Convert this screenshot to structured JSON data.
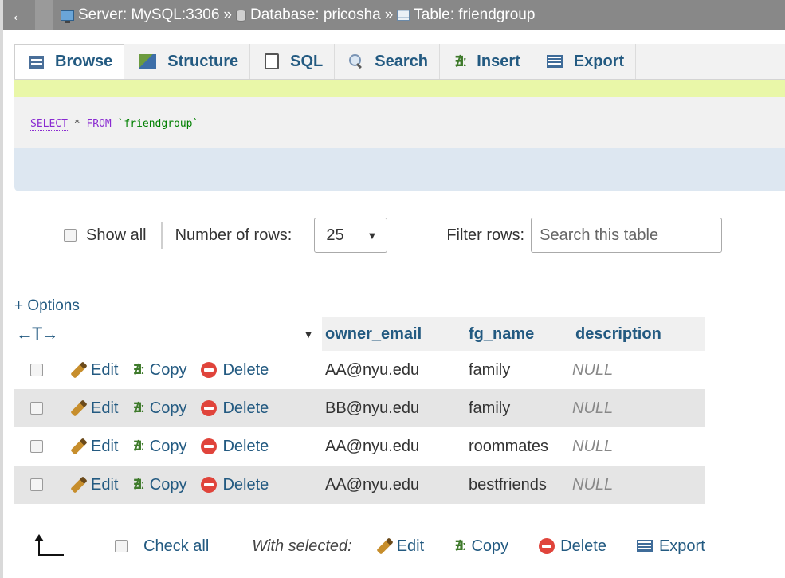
{
  "breadcrumb": {
    "back": "←",
    "server": "Server: MySQL:3306",
    "database": "Database: pricosha",
    "table": "Table: friendgroup",
    "separator": "»"
  },
  "tabs": [
    {
      "label": "Browse",
      "icon": "browse-icon",
      "active": true
    },
    {
      "label": "Structure",
      "icon": "structure-icon"
    },
    {
      "label": "SQL",
      "icon": "sql-icon"
    },
    {
      "label": "Search",
      "icon": "search-icon"
    },
    {
      "label": "Insert",
      "icon": "insert-icon"
    },
    {
      "label": "Export",
      "icon": "export-icon"
    }
  ],
  "query": {
    "select": "SELECT",
    "rest": " * ",
    "from": "FROM",
    "table": " `friendgroup`"
  },
  "controls": {
    "show_all": "Show all",
    "rows_label": "Number of rows:",
    "rows_value": "25",
    "filter_label": "Filter rows:",
    "filter_placeholder": "Search this table"
  },
  "options_link": "+ Options",
  "table": {
    "resize_arrows": "←T→",
    "columns": [
      "owner_email",
      "fg_name",
      "description"
    ],
    "actions": {
      "edit": "Edit",
      "copy": "Copy",
      "delete": "Delete"
    },
    "rows": [
      {
        "owner_email": "AA@nyu.edu",
        "fg_name": "family",
        "description": "NULL"
      },
      {
        "owner_email": "BB@nyu.edu",
        "fg_name": "family",
        "description": "NULL"
      },
      {
        "owner_email": "AA@nyu.edu",
        "fg_name": "roommates",
        "description": "NULL"
      },
      {
        "owner_email": "AA@nyu.edu",
        "fg_name": "bestfriends",
        "description": "NULL"
      }
    ]
  },
  "footer": {
    "check_all": "Check all",
    "with_selected": "With selected:",
    "edit": "Edit",
    "copy": "Copy",
    "delete": "Delete",
    "export": "Export"
  },
  "colors": {
    "link": "#235a81",
    "breadcrumb_bg": "#888888",
    "sql_highlight": "#e9f7a8",
    "row_alt": "#e5e5e5",
    "delete_red": "#e0443b"
  }
}
